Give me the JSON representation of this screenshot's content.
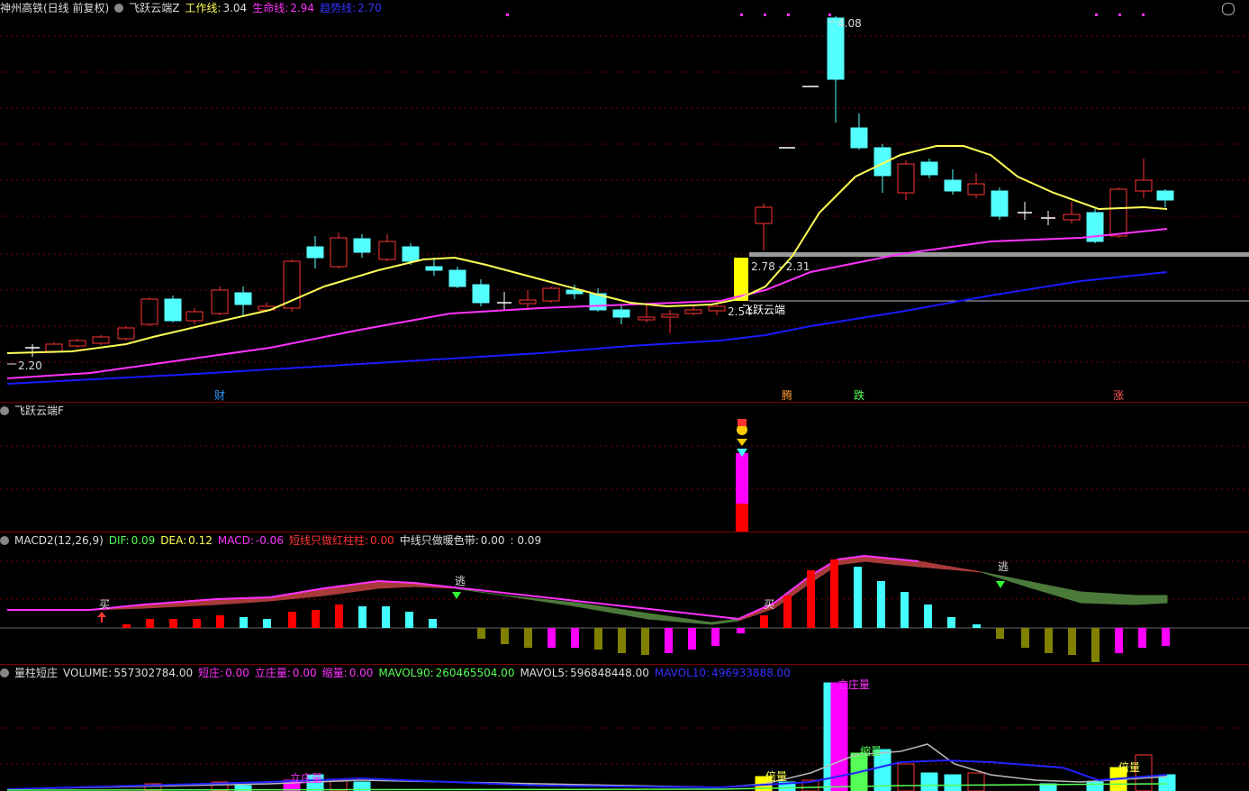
{
  "main": {
    "stock": "神州高铁(日线 前复权)",
    "indicator": "飞跃云端Z",
    "work_label": "工作线:",
    "work_value": "3.04",
    "life_label": "生命线:",
    "life_value": "2.94",
    "trend_label": "趋势线:",
    "trend_value": "2.70",
    "price_high": "4.08",
    "price_low": "2.20",
    "range_label": "2.78 - 2.31",
    "start_label": "2.54",
    "start_caption": "飞跃云端",
    "markers": [
      "财",
      "腾",
      "跌",
      "涨"
    ]
  },
  "feiyue": {
    "title": "飞跃云端F"
  },
  "macd": {
    "title": "MACD2(12,26,9)",
    "dif_label": "DIF:",
    "dif_value": "0.09",
    "dea_label": "DEA:",
    "dea_value": "0.12",
    "macd_label": "MACD:",
    "macd_value": "-0.06",
    "short_label": "短线只做红柱柱:",
    "short_value": "0.00",
    "mid_label": "中线只做暖色带:",
    "mid_value": "0.00",
    "extra_value": ": 0.09",
    "buy_label": "买",
    "escape_label": "逃"
  },
  "volume": {
    "title": "量柱短庄",
    "vol_label": "VOLUME:",
    "vol_value": "557302784.00",
    "short_label": "短庄:",
    "short_value": "0.00",
    "li_label": "立庄量:",
    "li_value": "0.00",
    "shrink_label": "缩量:",
    "shrink_value": "0.00",
    "mav90_label": "MAVOL90:",
    "mav90_value": "260465504.00",
    "mav5_label": "MAVOL5:",
    "mav5_value": "596848448.00",
    "mav10_label": "MAVOL10:",
    "mav10_value": "496933888.00",
    "bei_label": "倍量",
    "suo_label": "缩量",
    "li_short": "立庄量"
  },
  "colors": {
    "up": "#ff3333",
    "down": "#54ffff",
    "ma_yellow": "#ffff55",
    "ma_magenta": "#ff33ff",
    "ma_blue": "#1a1aff",
    "grid": "#7a0000"
  }
}
